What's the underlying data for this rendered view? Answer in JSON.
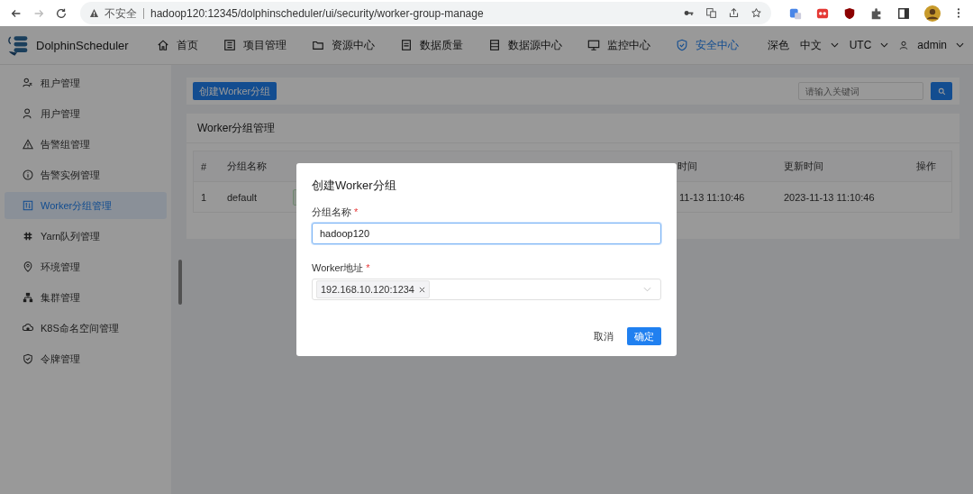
{
  "browser": {
    "security_label": "不安全",
    "url": "hadoop120:12345/dolphinscheduler/ui/security/worker-group-manage"
  },
  "header": {
    "logo": "DolphinScheduler",
    "nav": [
      {
        "label": "首页",
        "selected": false
      },
      {
        "label": "项目管理",
        "selected": false
      },
      {
        "label": "资源中心",
        "selected": false
      },
      {
        "label": "数据质量",
        "selected": false
      },
      {
        "label": "数据源中心",
        "selected": false
      },
      {
        "label": "监控中心",
        "selected": false
      },
      {
        "label": "安全中心",
        "selected": true
      }
    ],
    "theme": "深色",
    "language": "中文",
    "timezone": "UTC",
    "user": "admin"
  },
  "sidebar": {
    "items": [
      {
        "label": "租户管理",
        "selected": false
      },
      {
        "label": "用户管理",
        "selected": false
      },
      {
        "label": "告警组管理",
        "selected": false
      },
      {
        "label": "告警实例管理",
        "selected": false
      },
      {
        "label": "Worker分组管理",
        "selected": true
      },
      {
        "label": "Yarn队列管理",
        "selected": false
      },
      {
        "label": "环境管理",
        "selected": false
      },
      {
        "label": "集群管理",
        "selected": false
      },
      {
        "label": "K8S命名空间管理",
        "selected": false
      },
      {
        "label": "令牌管理",
        "selected": false
      }
    ]
  },
  "toolbar": {
    "create_button": "创建Worker分组",
    "search": {
      "placeholder": "请输入关键词"
    }
  },
  "panel": {
    "title": "Worker分组管理",
    "table": {
      "header": {
        "index": "#",
        "name": "分组名称",
        "created": "时间",
        "updated": "更新时间",
        "action": "操作"
      },
      "rows": [
        {
          "index": "1",
          "name": "default",
          "created": "11-13 11:10:46",
          "updated": "2023-11-13 11:10:46"
        }
      ]
    }
  },
  "modal": {
    "title": "创建Worker分组",
    "fields": [
      {
        "kind": "text",
        "label": "分组名称",
        "required_mark": "*",
        "value": "hadoop120"
      },
      {
        "kind": "select",
        "label": "Worker地址",
        "required_mark": "*",
        "tags": [
          "192.168.10.120:1234"
        ]
      }
    ],
    "cancel": "取消",
    "confirm": "确定"
  }
}
